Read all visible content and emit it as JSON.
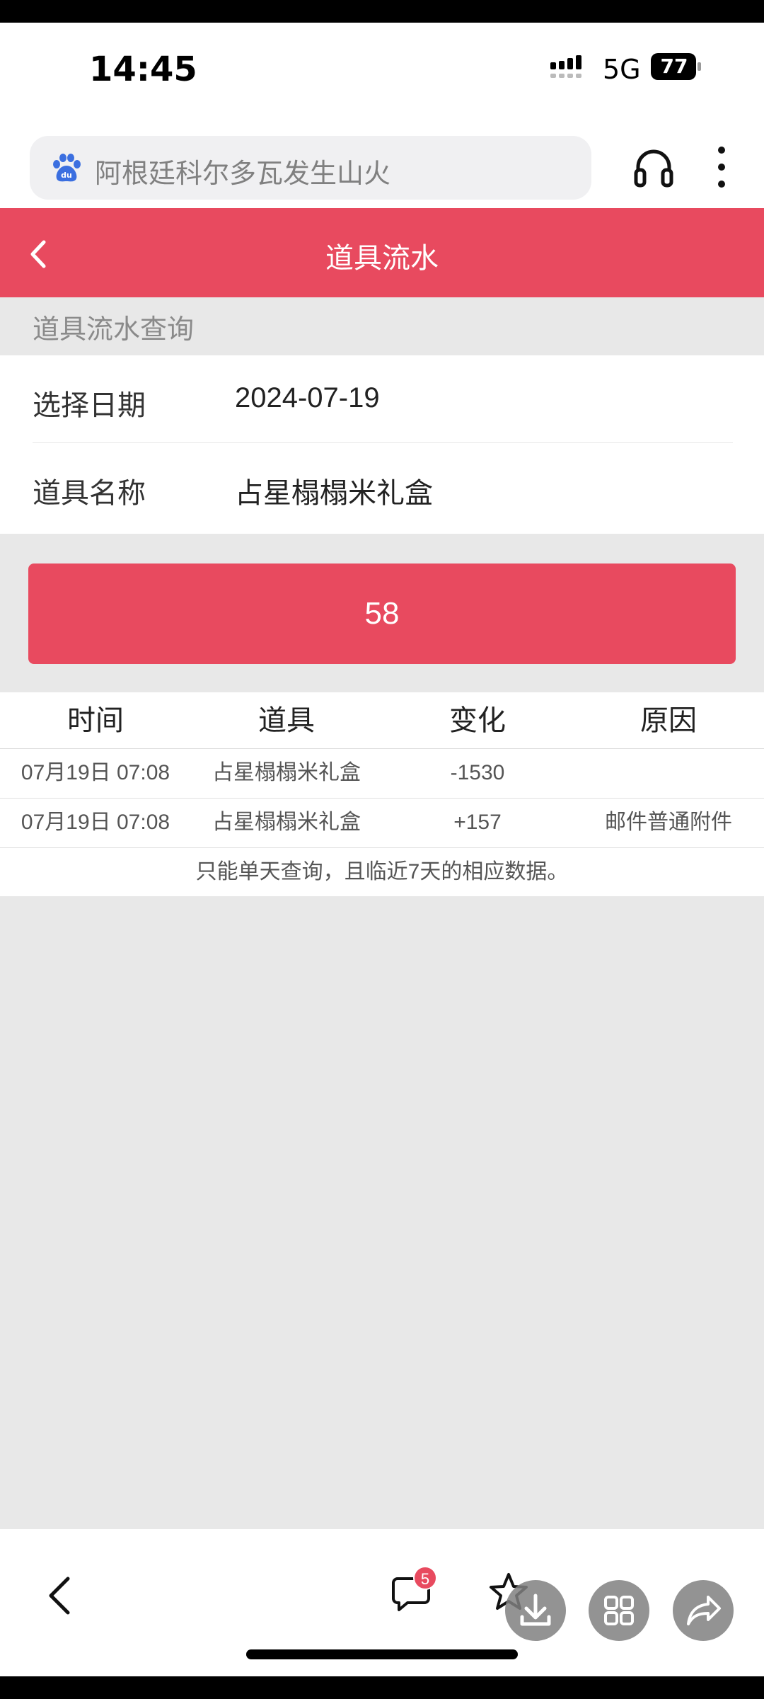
{
  "status": {
    "time": "14:45",
    "network": "5G",
    "battery": "77"
  },
  "browser": {
    "search_text": "阿根廷科尔多瓦发生山火",
    "search_icon": "baidu-paw-icon"
  },
  "header": {
    "title": "道具流水"
  },
  "query": {
    "section_title": "道具流水查询",
    "date_label": "选择日期",
    "date_value": "2024-07-19",
    "item_label": "道具名称",
    "item_value": "占星榻榻米礼盒"
  },
  "button": {
    "label": "58"
  },
  "table": {
    "headers": [
      "时间",
      "道具",
      "变化",
      "原因"
    ],
    "rows": [
      [
        "07月19日 07:08",
        "占星榻榻米礼盒",
        "-1530",
        ""
      ],
      [
        "07月19日 07:08",
        "占星榻榻米礼盒",
        "+157",
        "邮件普通附件"
      ]
    ],
    "note": "只能单天查询，且临近7天的相应数据。"
  },
  "bottom": {
    "comment_badge": "5"
  },
  "colors": {
    "accent": "#e84a5f",
    "background": "#e8e8e8"
  }
}
